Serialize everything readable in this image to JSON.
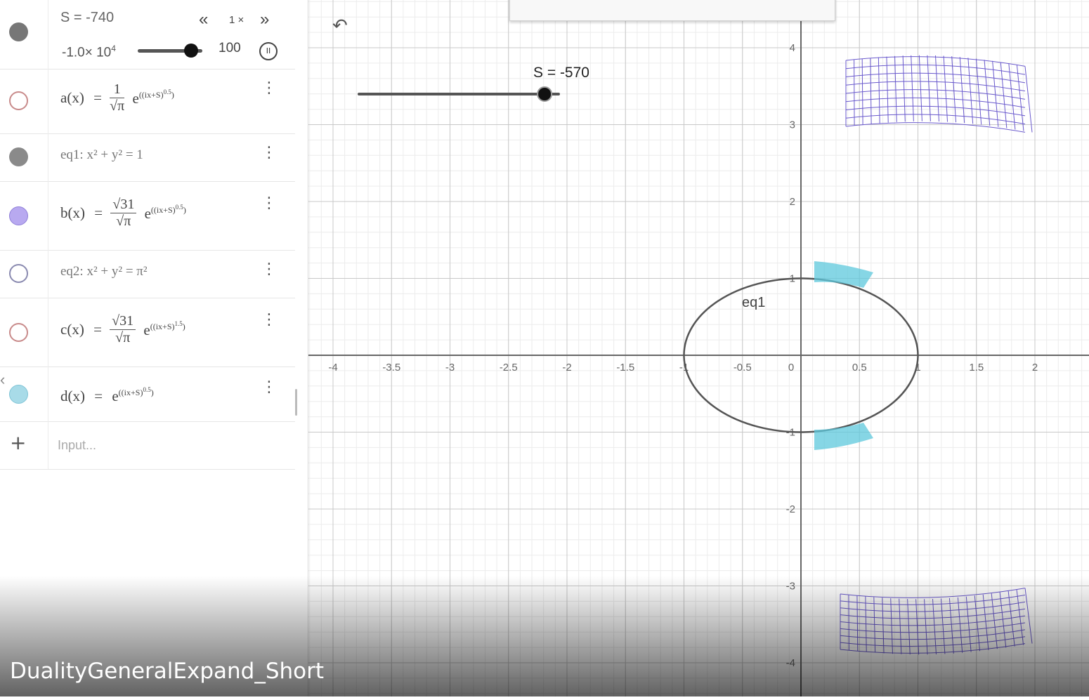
{
  "slider_panel": {
    "name_value": "S = -740",
    "min_label": "-1.0× 10",
    "min_exp": "4",
    "max_label": "100",
    "speed_label": "1 ×",
    "rewind_icon": "«",
    "forward_icon": "»",
    "pause_icon": "II"
  },
  "rows": {
    "a": {
      "lhs": "a(x)",
      "eq": "=",
      "num": "1",
      "den": "√π",
      "base": "e",
      "exp": "((ix+S)",
      "exp_pow": "0.5",
      "exp_close": ")"
    },
    "eq1": {
      "text": "eq1: x² + y² = 1"
    },
    "b": {
      "lhs": "b(x)",
      "eq": "=",
      "num": "√31",
      "den": "√π",
      "base": "e",
      "exp": "((ix+S)",
      "exp_pow": "0.5",
      "exp_close": ")"
    },
    "eq2": {
      "text": "eq2: x² + y² = π²"
    },
    "c": {
      "lhs": "c(x)",
      "eq": "=",
      "num": "√31",
      "den": "√π",
      "base": "e",
      "exp": "((ix+S)",
      "exp_pow": "1.5",
      "exp_close": ")"
    },
    "d": {
      "lhs": "d(x)",
      "eq": "=",
      "base": "e",
      "exp": "((ix+S)",
      "exp_pow": "0.5",
      "exp_close": ")"
    },
    "input_placeholder": "Input..."
  },
  "colors": {
    "gray_dot": "#777777",
    "b_dot": "#b8a9f0",
    "d_dot": "#a8dbe8",
    "open_dot_red": "#c88a8a",
    "open_dot_blue": "#8a8ab0",
    "grid_major": "#c8c8c8",
    "grid_minor": "#ececec",
    "ellipse": "#555555",
    "purple_mesh": "#6a5acd",
    "cyan_mesh": "#5ec8dc"
  },
  "graphics": {
    "slider_label": "S = -570",
    "slider_fraction": 0.93,
    "eq1_label": "eq1",
    "x_ticks": [
      "-4",
      "-3.5",
      "-3",
      "-2.5",
      "-2",
      "-1.5",
      "-1",
      "-0.5",
      "0",
      "0.5",
      "1",
      "1.5",
      "2",
      "2"
    ],
    "y_ticks": [
      "4",
      "3",
      "2",
      "1",
      "-1",
      "-2",
      "-3",
      "-4"
    ],
    "undo_icon": "undo-icon"
  },
  "video_title": "DualityGeneralExpand_Short"
}
